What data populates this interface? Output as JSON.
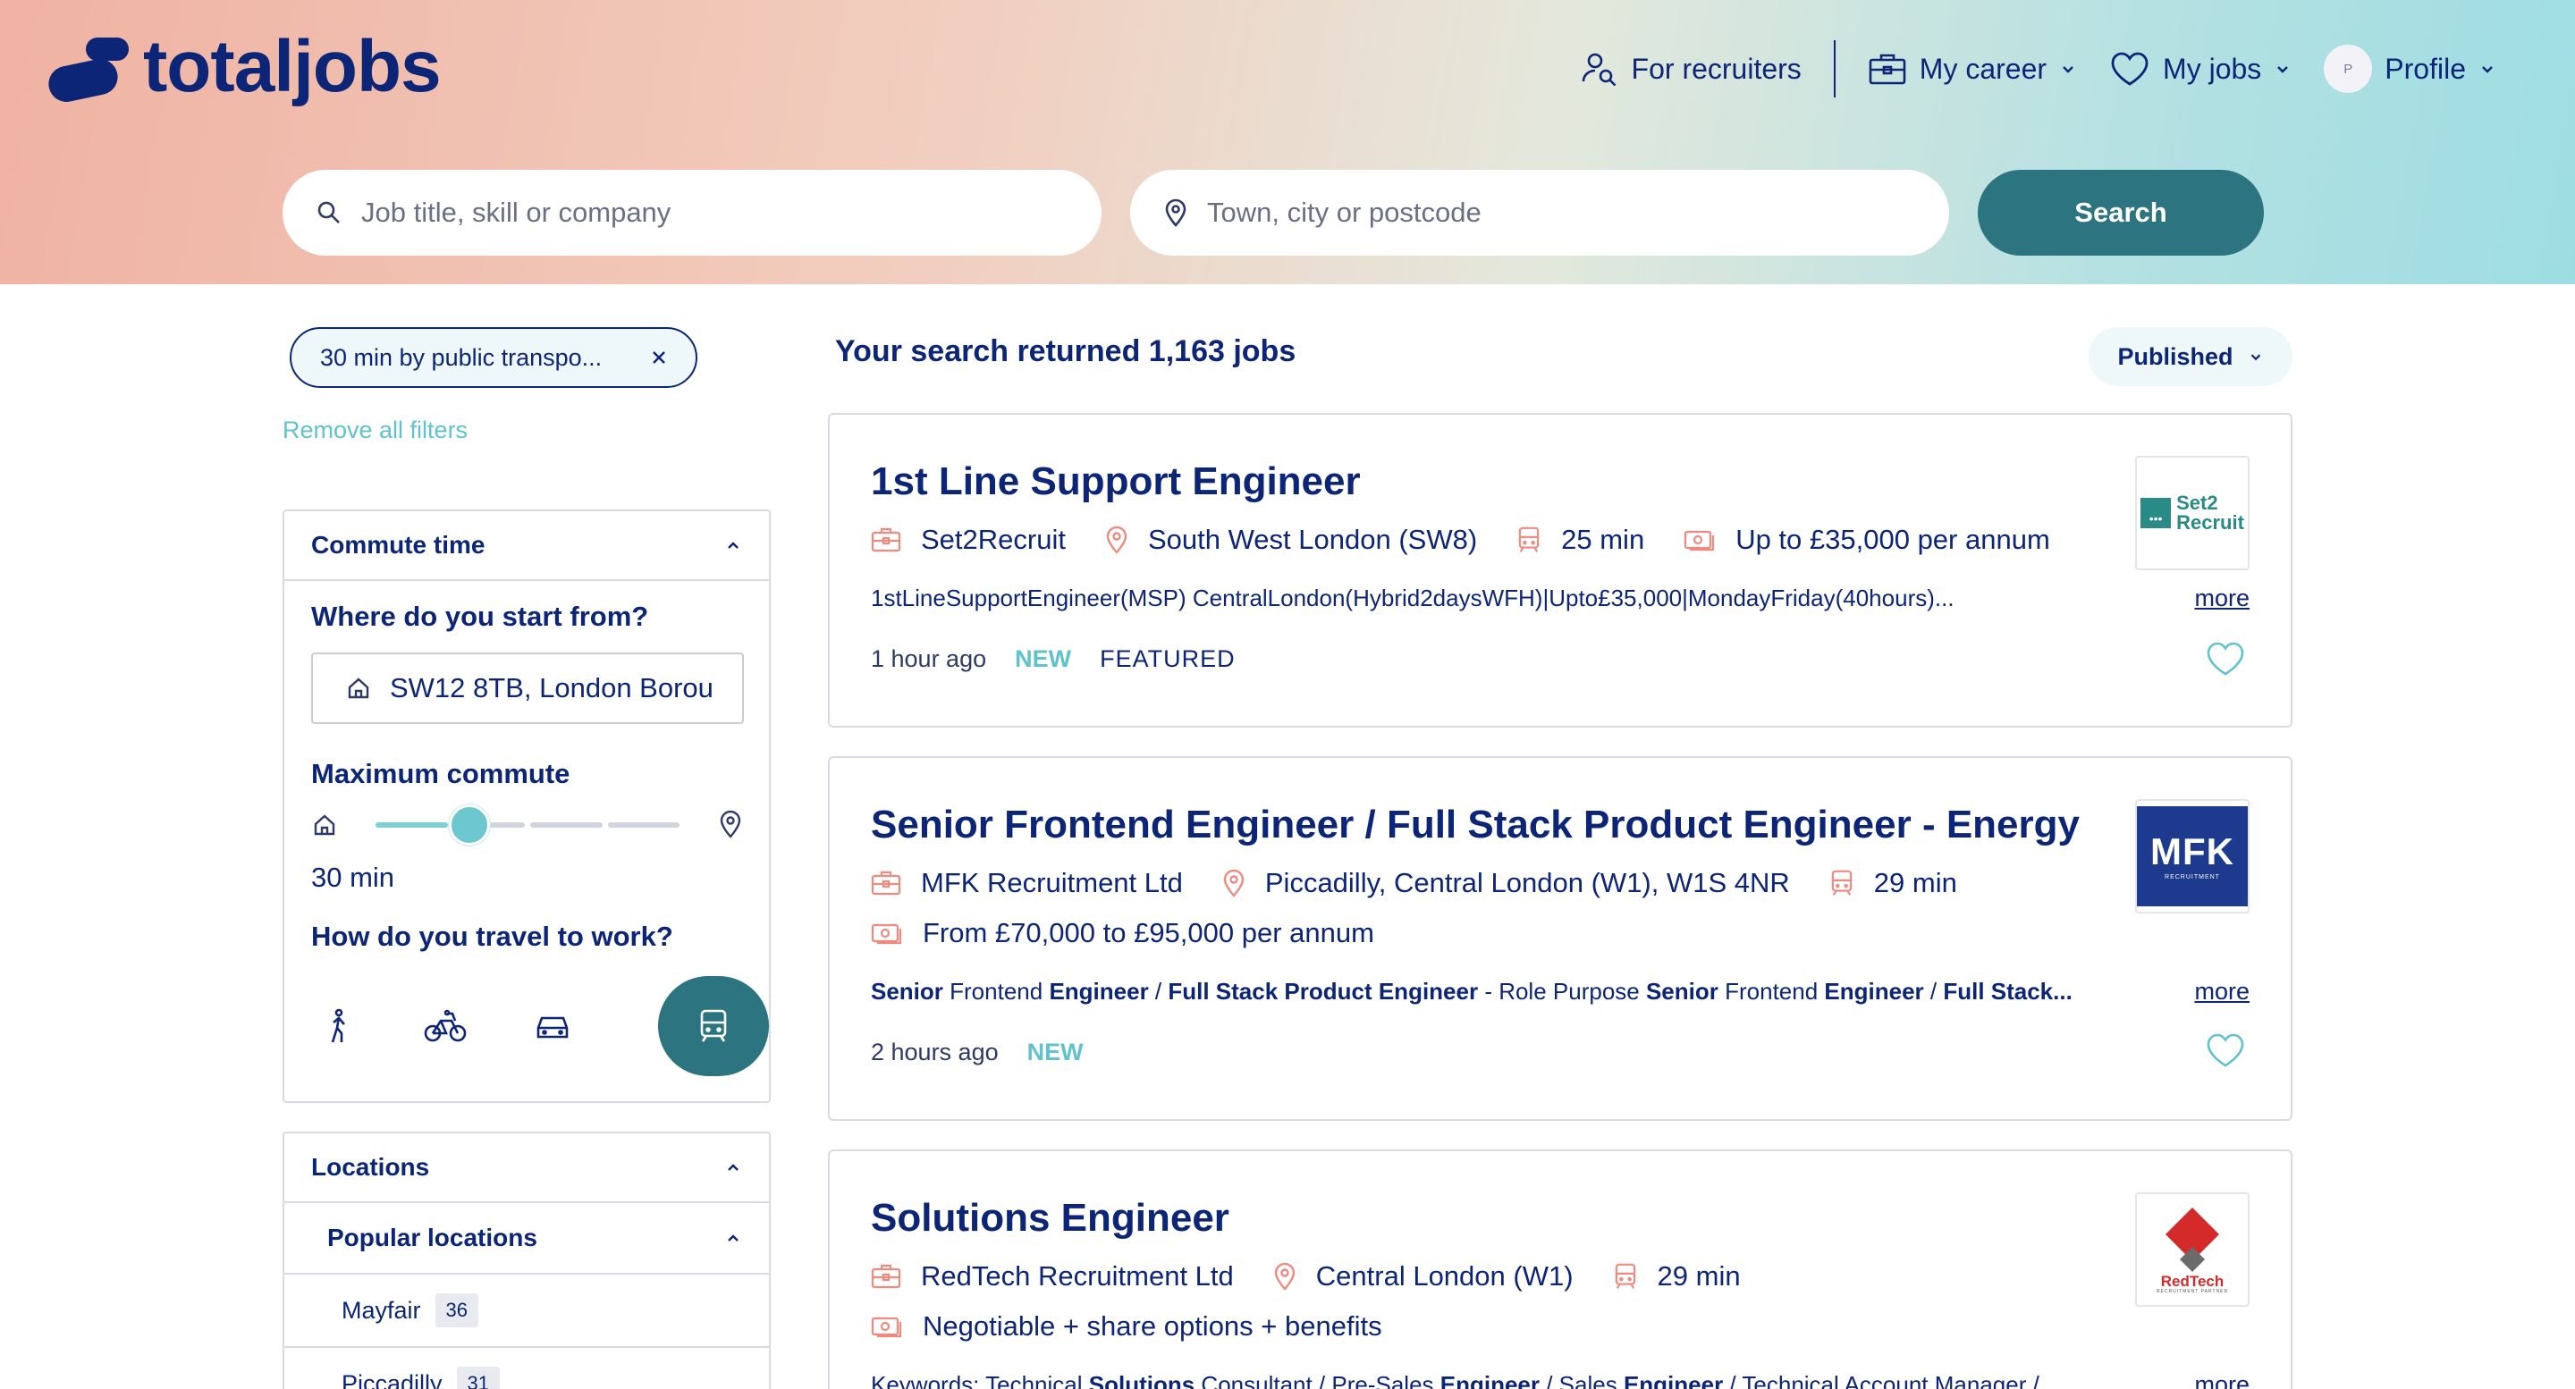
{
  "brand": {
    "name": "totaljobs"
  },
  "nav": {
    "recruiters": "For recruiters",
    "career": "My career",
    "jobs": "My jobs",
    "avatar_initial": "P",
    "profile": "Profile"
  },
  "search": {
    "what_placeholder": "Job title, skill or company",
    "where_placeholder": "Town, city or postcode",
    "button": "Search"
  },
  "filters": {
    "active_chip": "30 min by public transpo...",
    "remove_all": "Remove all filters"
  },
  "commute": {
    "header": "Commute time",
    "start_heading": "Where do you start from?",
    "start_value": "SW12 8TB, London Borou",
    "max_heading": "Maximum commute",
    "max_value": "30 min",
    "max_fraction": 0.25,
    "travel_heading": "How do you travel to work?",
    "modes": [
      "walk-icon",
      "bike-icon",
      "car-icon",
      "train-icon"
    ],
    "active_mode": "train-icon"
  },
  "locations": {
    "header": "Locations",
    "popular_header": "Popular locations",
    "items": [
      {
        "name": "Mayfair",
        "count": "36"
      },
      {
        "name": "Piccadilly",
        "count": "31"
      }
    ]
  },
  "results": {
    "title": "Your search returned 1,163 jobs",
    "sort": "Published",
    "jobs": [
      {
        "title": "1st Line Support Engineer",
        "company": "Set2Recruit",
        "location": "South West London (SW8)",
        "commute": "25 min",
        "salary": "Up to £35,000 per annum",
        "snippet": "1stLineSupportEngineer(MSP) CentralLondon(Hybrid2daysWFH)|Upto£35,000|MondayFriday(40hours)...",
        "posted": "1 hour ago",
        "new": "NEW",
        "featured": "FEATURED",
        "logo_text_1": "Set2",
        "logo_text_2": "Recruit",
        "more": "more"
      },
      {
        "title": "Senior Frontend Engineer / Full Stack Product Engineer - Energy",
        "company": "MFK Recruitment Ltd",
        "location": "Piccadilly, Central London (W1), W1S 4NR",
        "commute": "29 min",
        "salary": "From £70,000 to £95,000 per annum",
        "snippet_parts": [
          "Senior",
          " Frontend ",
          "Engineer",
          " / ",
          "Full Stack Product Engineer",
          " - Role Purpose ",
          "Senior",
          " Frontend ",
          "Engineer",
          " / ",
          "Full Stack..."
        ],
        "posted": "2 hours ago",
        "new": "NEW",
        "logo_text": "MFK",
        "logo_sub": "RECRUITMENT",
        "more": "more"
      },
      {
        "title": "Solutions Engineer",
        "company": "RedTech Recruitment Ltd",
        "location": "Central London (W1)",
        "commute": "29 min",
        "salary": "Negotiable + share options + benefits",
        "snippet_parts": [
          "Keywords: Technical ",
          "Solutions",
          " Consultant / Pre-Sales ",
          "Engineer",
          " / Sales ",
          "Engineer",
          " / Technical Account Manager /"
        ],
        "logo_text": "RedTech",
        "logo_sub": "RECRUITMENT PARTNER",
        "more": "more"
      }
    ]
  },
  "colors": {
    "navy": "#0c2577",
    "teal": "#2b7480",
    "aqua": "#5fc2cd",
    "coral": "#f08a7e"
  }
}
